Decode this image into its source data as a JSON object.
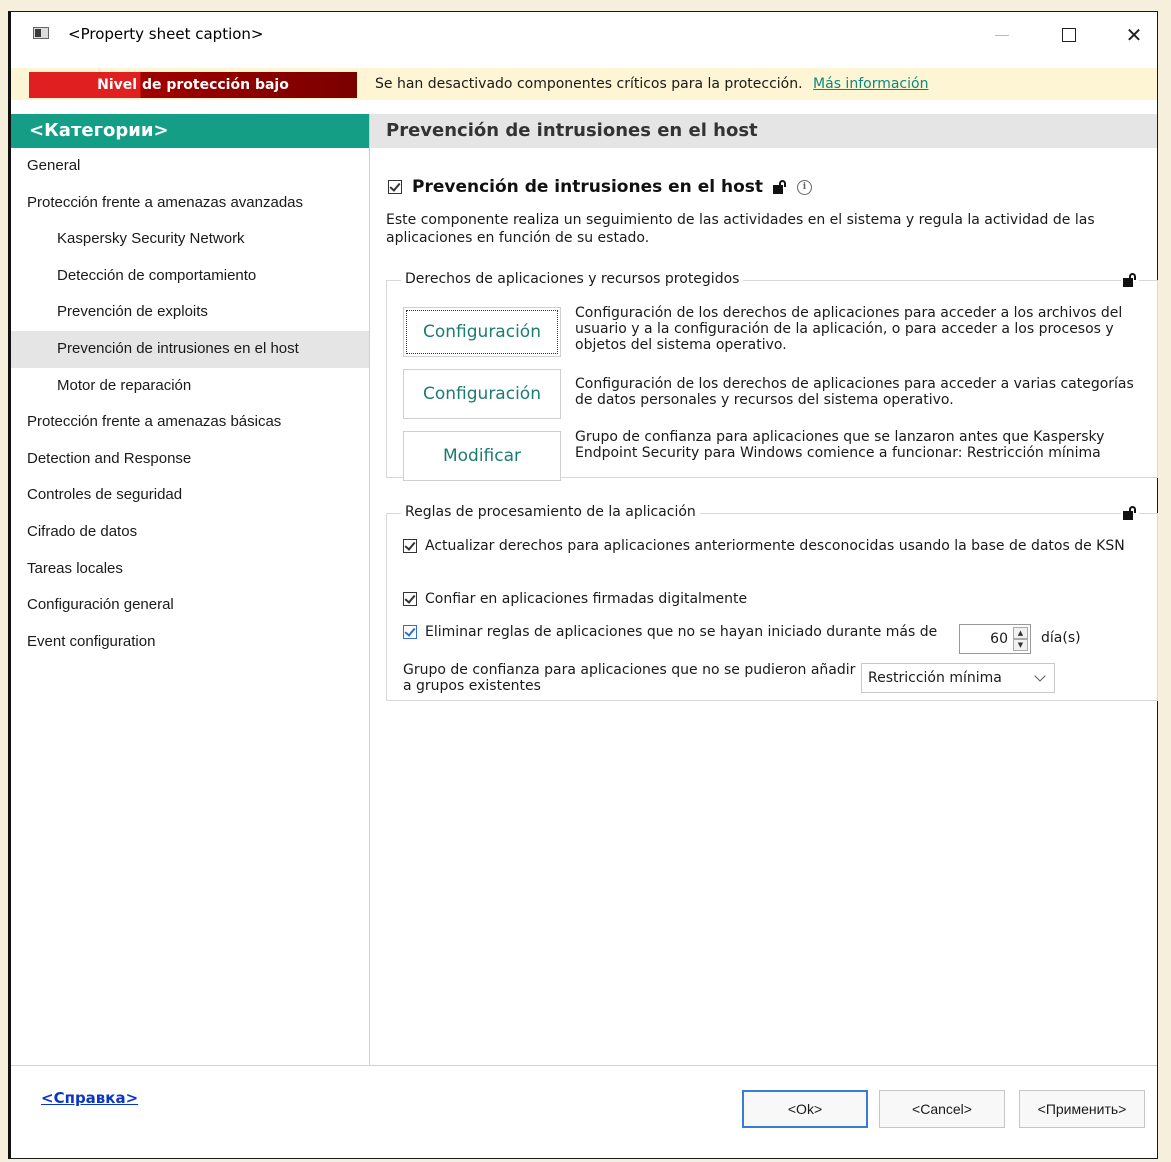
{
  "window": {
    "title": "<Property sheet caption>"
  },
  "banner": {
    "level": "Nivel de protección bajo",
    "message": "Se han desactivado componentes críticos para la protección.",
    "link": "Más información"
  },
  "sidebar": {
    "header": "<Категории>",
    "items": [
      {
        "label": "General",
        "sub": false
      },
      {
        "label": "Protección frente a amenazas avanzadas",
        "sub": false
      },
      {
        "label": "Kaspersky Security Network",
        "sub": true
      },
      {
        "label": "Detección de comportamiento",
        "sub": true
      },
      {
        "label": "Prevención de exploits",
        "sub": true
      },
      {
        "label": "Prevención de intrusiones en el host",
        "sub": true,
        "active": true
      },
      {
        "label": "Motor de reparación",
        "sub": true
      },
      {
        "label": "Protección frente a amenazas básicas",
        "sub": false
      },
      {
        "label": "Detection and Response",
        "sub": false
      },
      {
        "label": "Controles de seguridad",
        "sub": false
      },
      {
        "label": "Cifrado de datos",
        "sub": false
      },
      {
        "label": "Tareas locales",
        "sub": false
      },
      {
        "label": "Configuración general",
        "sub": false
      },
      {
        "label": "Event configuration",
        "sub": false
      }
    ]
  },
  "main": {
    "header": "Prevención de intrusiones en el host",
    "component_title": "Prevención de intrusiones en el host",
    "component_enabled": true,
    "component_desc": "Este componente realiza un seguimiento de las actividades en el sistema y regula la actividad de las aplicaciones en función de su estado.",
    "rights_group": {
      "title": "Derechos de aplicaciones y recursos protegidos",
      "rows": [
        {
          "button": "Configuración",
          "desc": "Configuración de los derechos de aplicaciones para acceder a los archivos del usuario y a la configuración de la aplicación, o para acceder a los procesos y objetos del sistema operativo."
        },
        {
          "button": "Configuración",
          "desc": "Configuración de los derechos de aplicaciones para acceder a varias categorías de datos personales y recursos del sistema operativo."
        },
        {
          "button": "Modificar",
          "desc": "Grupo de confianza para aplicaciones que se lanzaron antes que Kaspersky Endpoint Security para Windows comience a funcionar: Restricción mínima"
        }
      ]
    },
    "rules_group": {
      "title": "Reglas de procesamiento de la aplicación",
      "update_rights": "Actualizar derechos para aplicaciones anteriormente desconocidas usando la base de datos de KSN",
      "trust_signed": "Confiar en aplicaciones firmadas digitalmente",
      "delete_rules": "Eliminar reglas de aplicaciones que no se hayan iniciado durante más de",
      "days_value": "60",
      "days_unit": "día(s)",
      "trust_group_label": "Grupo de confianza para aplicaciones que no se pudieron añadir a grupos existentes",
      "trust_group_value": "Restricción mínima"
    }
  },
  "footer": {
    "help": "<Справка>",
    "ok": "<Ok>",
    "cancel": "<Cancel>",
    "apply": "<Применить>"
  },
  "colors": {
    "accent": "#149e86",
    "danger": "#e02020",
    "link": "#0a8a7e",
    "help_link": "#0a35c8"
  }
}
